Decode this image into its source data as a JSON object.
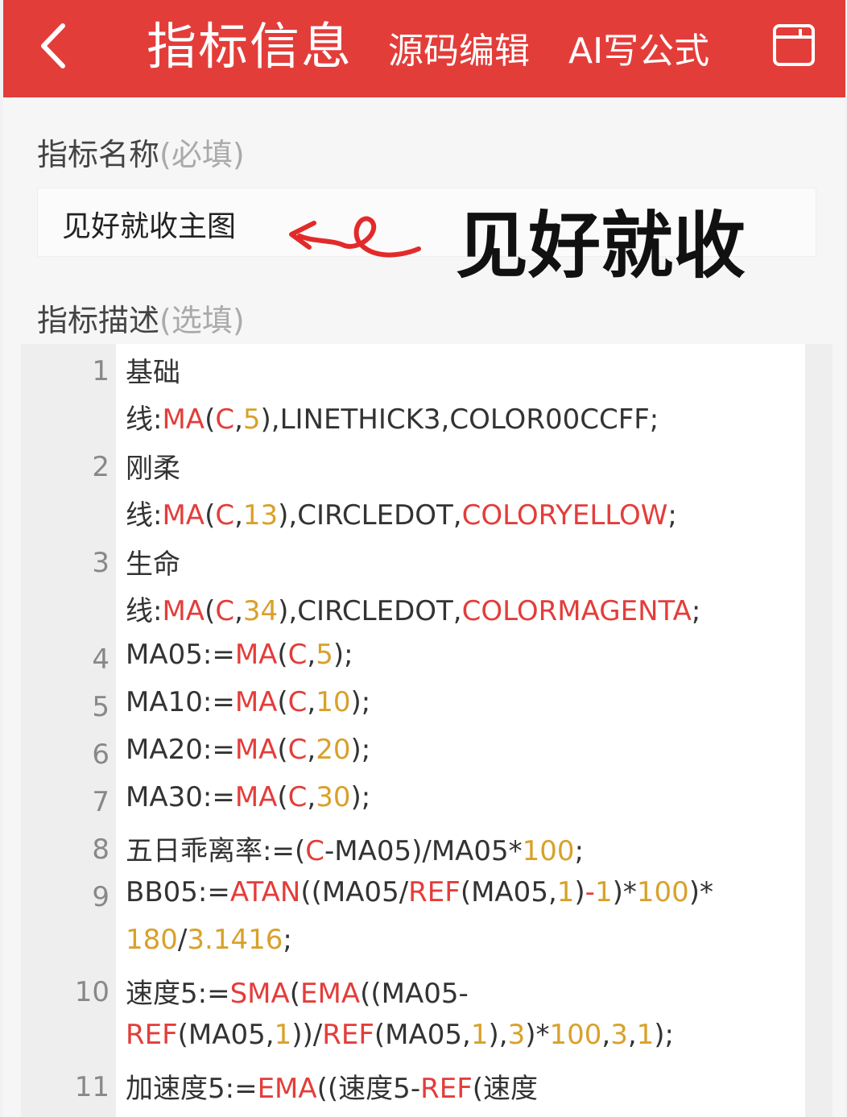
{
  "header": {
    "title": "指标信息",
    "source_edit": "源码编辑",
    "ai_formula": "AI写公式"
  },
  "form": {
    "name_label": "指标名称",
    "name_hint": "(必填)",
    "name_value": "见好就收主图",
    "desc_label": "指标描述",
    "desc_hint": "(选填)"
  },
  "annotation": {
    "text": "见好就收"
  },
  "code": {
    "line_numbers": [
      "1",
      "2",
      "3",
      "4",
      "5",
      "6",
      "7",
      "8",
      "9",
      "10",
      "11"
    ],
    "lines": [
      [
        {
          "t": "基础",
          "c": ""
        }
      ],
      [
        {
          "t": "线:",
          "c": ""
        },
        {
          "t": "MA",
          "c": "r"
        },
        {
          "t": "(",
          "c": ""
        },
        {
          "t": "C",
          "c": "r"
        },
        {
          "t": ",",
          "c": ""
        },
        {
          "t": "5",
          "c": "o"
        },
        {
          "t": "),LINETHICK3,COLOR00CCFF;",
          "c": ""
        }
      ],
      [
        {
          "t": "刚柔",
          "c": ""
        }
      ],
      [
        {
          "t": "线:",
          "c": ""
        },
        {
          "t": "MA",
          "c": "r"
        },
        {
          "t": "(",
          "c": ""
        },
        {
          "t": "C",
          "c": "r"
        },
        {
          "t": ",",
          "c": ""
        },
        {
          "t": "13",
          "c": "o"
        },
        {
          "t": "),CIRCLEDOT,",
          "c": ""
        },
        {
          "t": "COLORYELLOW",
          "c": "r"
        },
        {
          "t": ";",
          "c": ""
        }
      ],
      [
        {
          "t": "生命",
          "c": ""
        }
      ],
      [
        {
          "t": "线:",
          "c": ""
        },
        {
          "t": "MA",
          "c": "r"
        },
        {
          "t": "(",
          "c": ""
        },
        {
          "t": "C",
          "c": "r"
        },
        {
          "t": ",",
          "c": ""
        },
        {
          "t": "34",
          "c": "o"
        },
        {
          "t": "),CIRCLEDOT,",
          "c": ""
        },
        {
          "t": "COLORMAGENTA",
          "c": "r"
        },
        {
          "t": ";",
          "c": ""
        }
      ],
      [
        {
          "t": "MA05:=",
          "c": ""
        },
        {
          "t": "MA",
          "c": "r"
        },
        {
          "t": "(",
          "c": ""
        },
        {
          "t": "C",
          "c": "r"
        },
        {
          "t": ",",
          "c": ""
        },
        {
          "t": "5",
          "c": "o"
        },
        {
          "t": ");",
          "c": ""
        }
      ],
      [
        {
          "t": "MA10:=",
          "c": ""
        },
        {
          "t": "MA",
          "c": "r"
        },
        {
          "t": "(",
          "c": ""
        },
        {
          "t": "C",
          "c": "r"
        },
        {
          "t": ",",
          "c": ""
        },
        {
          "t": "10",
          "c": "o"
        },
        {
          "t": ");",
          "c": ""
        }
      ],
      [
        {
          "t": "MA20:=",
          "c": ""
        },
        {
          "t": "MA",
          "c": "r"
        },
        {
          "t": "(",
          "c": ""
        },
        {
          "t": "C",
          "c": "r"
        },
        {
          "t": ",",
          "c": ""
        },
        {
          "t": "20",
          "c": "o"
        },
        {
          "t": ");",
          "c": ""
        }
      ],
      [
        {
          "t": "MA30:=",
          "c": ""
        },
        {
          "t": "MA",
          "c": "r"
        },
        {
          "t": "(",
          "c": ""
        },
        {
          "t": "C",
          "c": "r"
        },
        {
          "t": ",",
          "c": ""
        },
        {
          "t": "30",
          "c": "o"
        },
        {
          "t": ");",
          "c": ""
        }
      ],
      [
        {
          "t": "五日乖离率:=(",
          "c": ""
        },
        {
          "t": "C",
          "c": "r"
        },
        {
          "t": "-MA05)/MA05*",
          "c": ""
        },
        {
          "t": "100",
          "c": "o"
        },
        {
          "t": ";",
          "c": ""
        }
      ],
      [
        {
          "t": "BB05:=",
          "c": ""
        },
        {
          "t": "ATAN",
          "c": "r"
        },
        {
          "t": "((MA05/",
          "c": ""
        },
        {
          "t": "REF",
          "c": "r"
        },
        {
          "t": "(MA05,",
          "c": ""
        },
        {
          "t": "1",
          "c": "o"
        },
        {
          "t": ")",
          "c": ""
        },
        {
          "t": "-",
          "c": "r"
        },
        {
          "t": "1",
          "c": "o"
        },
        {
          "t": ")*",
          "c": ""
        },
        {
          "t": "100",
          "c": "o"
        },
        {
          "t": ")*",
          "c": ""
        }
      ],
      [
        {
          "t": "180",
          "c": "o"
        },
        {
          "t": "/",
          "c": ""
        },
        {
          "t": "3.1416",
          "c": "o"
        },
        {
          "t": ";",
          "c": ""
        }
      ],
      [
        {
          "t": "速度5:=",
          "c": ""
        },
        {
          "t": "SMA",
          "c": "r"
        },
        {
          "t": "(",
          "c": ""
        },
        {
          "t": "EMA",
          "c": "r"
        },
        {
          "t": "((MA05-",
          "c": ""
        }
      ],
      [
        {
          "t": "REF",
          "c": "r"
        },
        {
          "t": "(MA05,",
          "c": ""
        },
        {
          "t": "1",
          "c": "o"
        },
        {
          "t": "))/",
          "c": ""
        },
        {
          "t": "REF",
          "c": "r"
        },
        {
          "t": "(MA05,",
          "c": ""
        },
        {
          "t": "1",
          "c": "o"
        },
        {
          "t": "),",
          "c": ""
        },
        {
          "t": "3",
          "c": "o"
        },
        {
          "t": ")*",
          "c": ""
        },
        {
          "t": "100",
          "c": "o"
        },
        {
          "t": ",",
          "c": ""
        },
        {
          "t": "3",
          "c": "o"
        },
        {
          "t": ",",
          "c": ""
        },
        {
          "t": "1",
          "c": "o"
        },
        {
          "t": ");",
          "c": ""
        }
      ],
      [
        {
          "t": "加速度5:=",
          "c": ""
        },
        {
          "t": "EMA",
          "c": "r"
        },
        {
          "t": "((速度5-",
          "c": ""
        },
        {
          "t": "REF",
          "c": "r"
        },
        {
          "t": "(速度",
          "c": ""
        }
      ]
    ]
  },
  "colors": {
    "header_bg": "#e33d3a",
    "keyword": "#e33d3a",
    "number": "#d9a12a"
  }
}
